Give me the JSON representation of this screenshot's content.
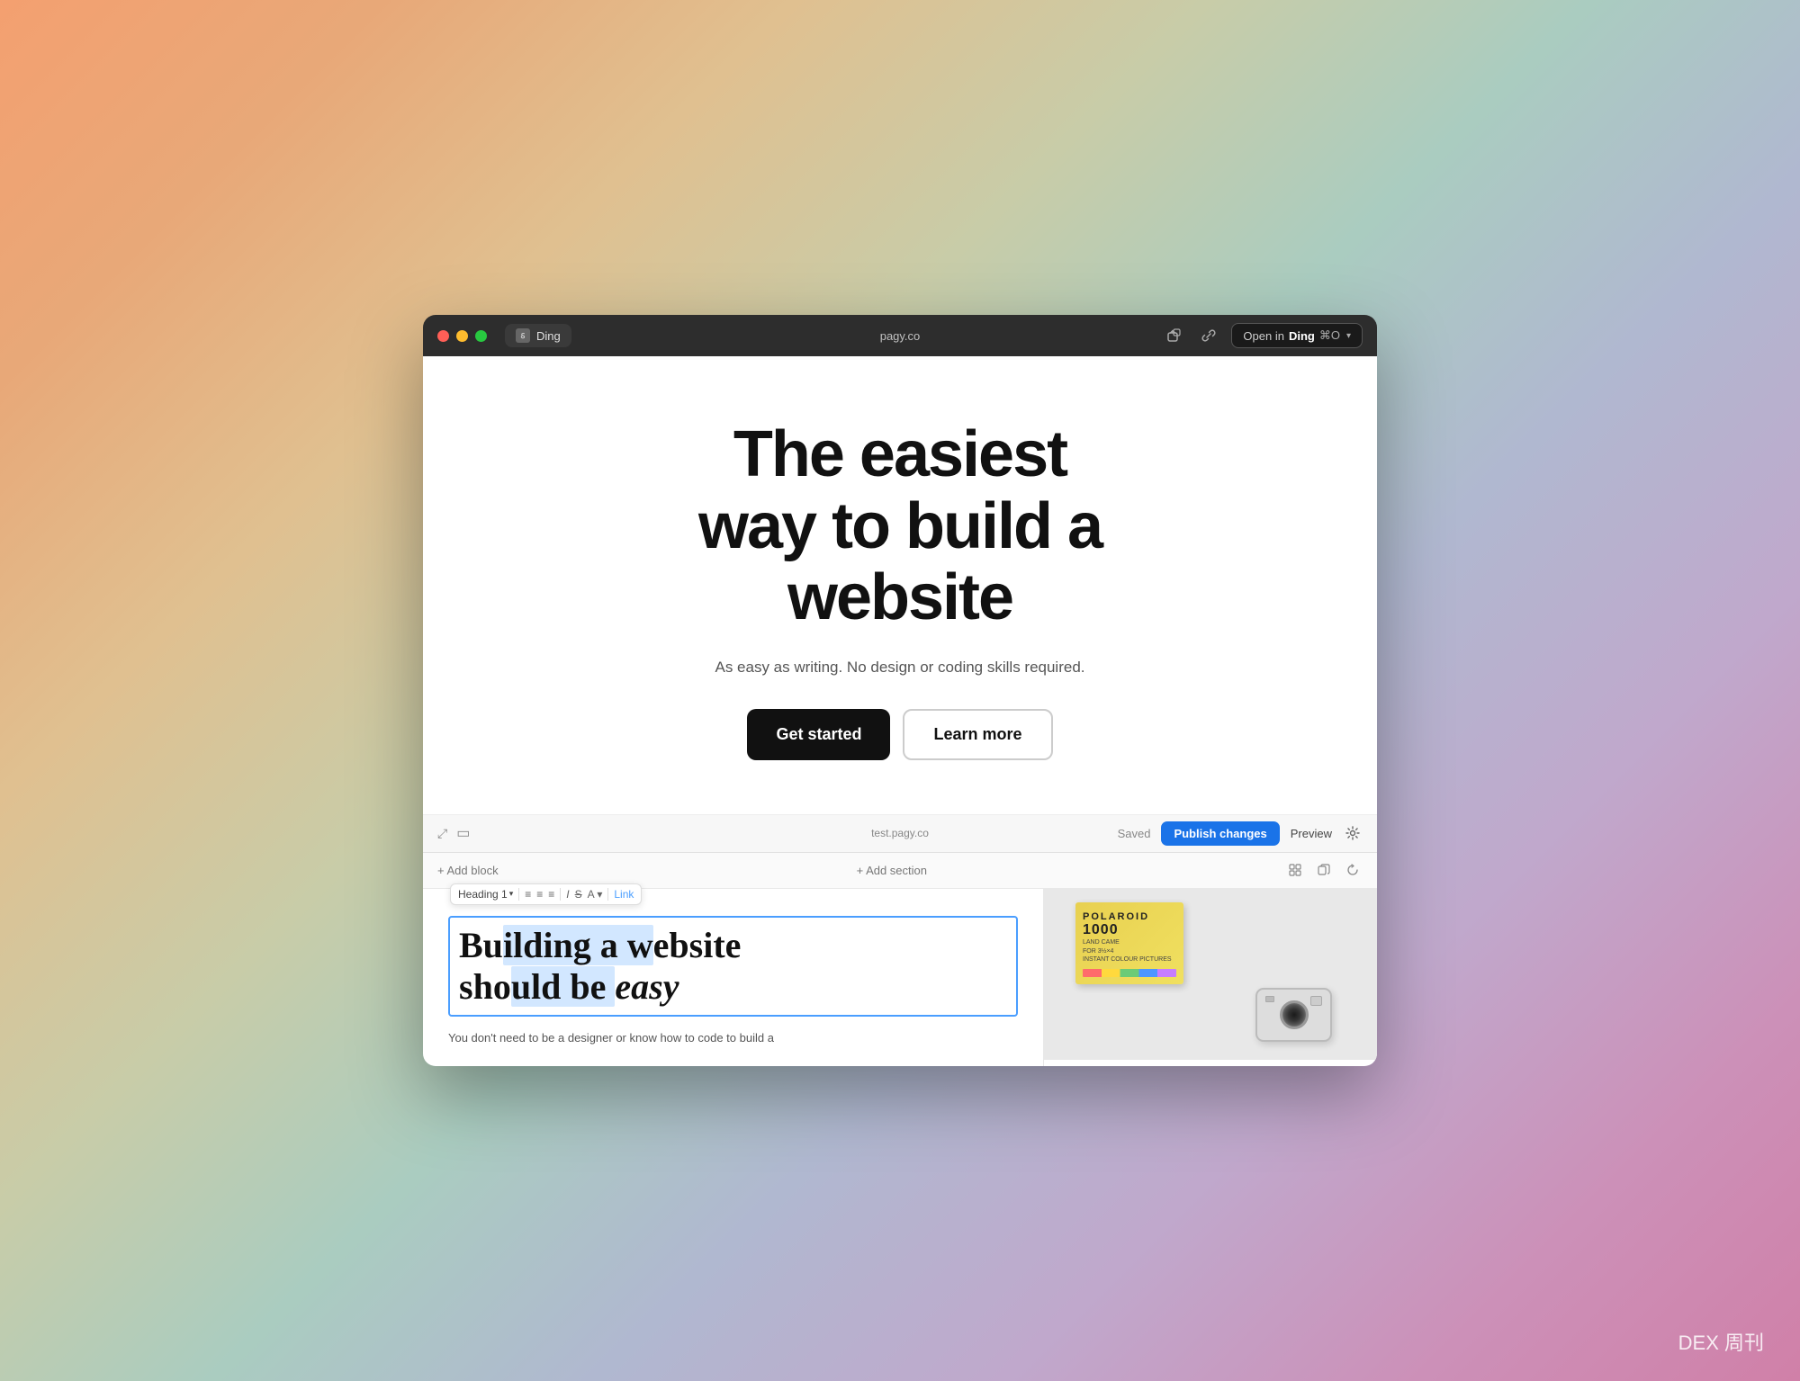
{
  "background": {
    "gradient": "linear-gradient(135deg, #f4a070, #e8c090, #c8d4c0, #c0a8d0, #d090b8)"
  },
  "dex_label": "DEX 周刊",
  "browser": {
    "traffic_lights": [
      "close",
      "minimize",
      "maximize"
    ],
    "tab": {
      "icon": "Ding",
      "label": "Ding"
    },
    "url": "pagy.co",
    "open_in_label": "Open in",
    "app_name": "Ding",
    "shortcut": "⌘O"
  },
  "hero": {
    "title": "The easiest way to build a website",
    "subtitle": "As easy as writing. No design or coding skills required.",
    "get_started_label": "Get started",
    "learn_more_label": "Learn more"
  },
  "editor": {
    "toolbar": {
      "url": "test.pagy.co",
      "saved_label": "Saved",
      "publish_label": "Publish changes",
      "preview_label": "Preview"
    },
    "add_block_label": "+ Add block",
    "add_section_label": "+ Add section",
    "inline_toolbar": {
      "heading_label": "Heading 1",
      "align_left": "≡",
      "align_center": "≡",
      "align_right": "≡",
      "italic_label": "I",
      "strikethrough_label": "S",
      "font_label": "A",
      "link_label": "Link"
    },
    "content": {
      "heading": "Building a website should be easy",
      "body": "You don't need to be a designer or know how to code to build a"
    }
  }
}
